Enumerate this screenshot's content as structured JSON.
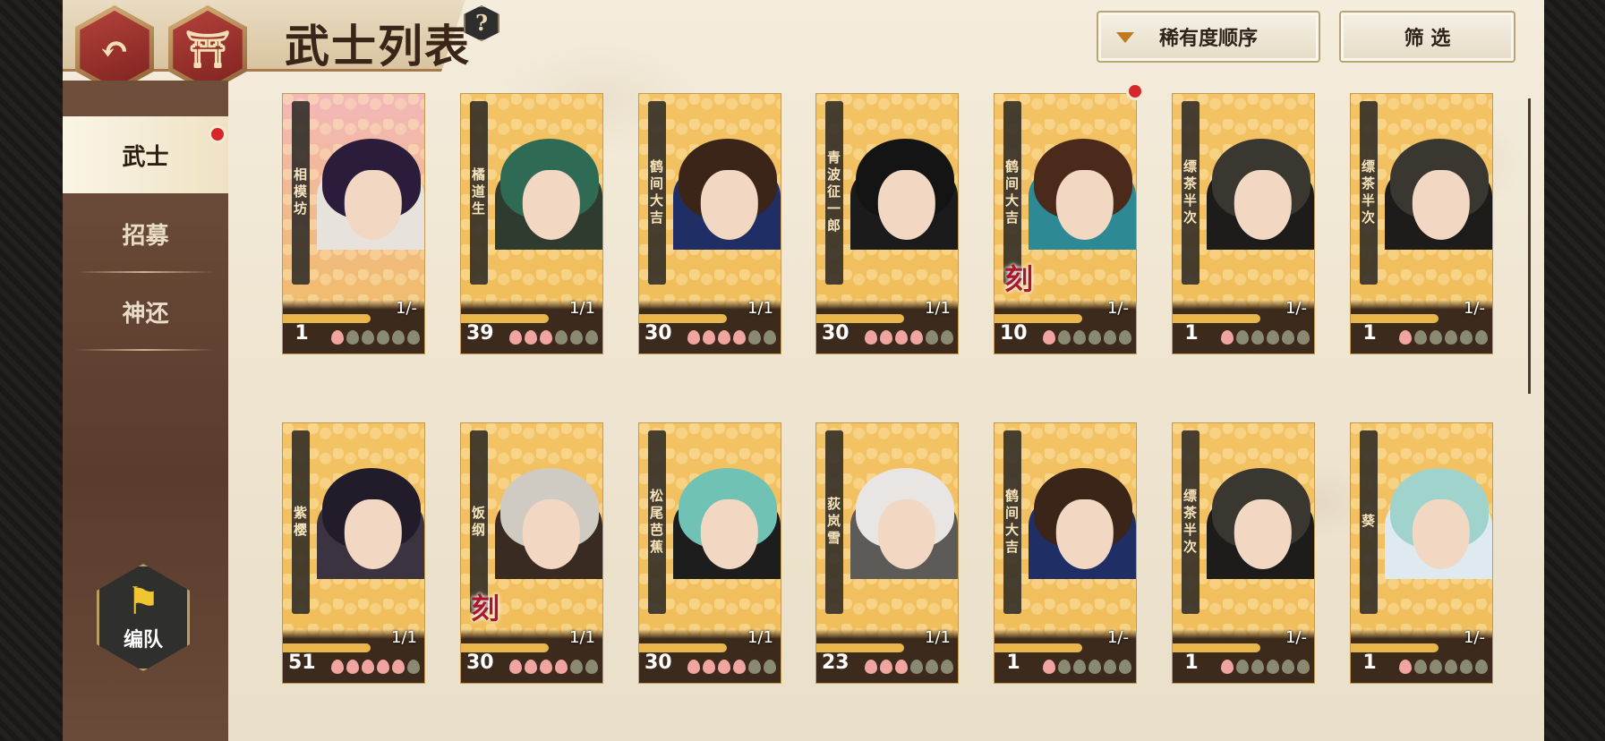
{
  "header": {
    "title": "武士列表",
    "help_label": "?",
    "sort_label": "稀有度顺序",
    "filter_label": "筛 选",
    "back_glyph": "↶",
    "home_glyph": "⛩"
  },
  "sidebar": {
    "items": [
      {
        "label": "武士",
        "active": true,
        "badge": true
      },
      {
        "label": "招募",
        "active": false,
        "badge": false
      },
      {
        "label": "神还",
        "active": false,
        "badge": false
      }
    ],
    "team": {
      "label": "编队",
      "flag": "⚑"
    }
  },
  "colors": {
    "accent_red": "#d9262a",
    "card_gold": "#f3c264",
    "sidebar_brown": "#5a3c2d",
    "petal_on": "#f0a5a0",
    "petal_off": "#8a8a72"
  },
  "cards": [
    {
      "name": "相模坊",
      "level": "1",
      "count": "1/-",
      "petals": 1,
      "theme": "red",
      "seal": "",
      "badge": false
    },
    {
      "name": "橘道生",
      "level": "39",
      "count": "1/1",
      "petals": 3,
      "theme": "green",
      "seal": "",
      "badge": false
    },
    {
      "name": "鹤间大吉",
      "level": "30",
      "count": "1/1",
      "petals": 4,
      "theme": "navy",
      "seal": "",
      "badge": false
    },
    {
      "name": "青波征一郎",
      "level": "30",
      "count": "1/1",
      "petals": 4,
      "theme": "black",
      "seal": "",
      "badge": false
    },
    {
      "name": "鹤间大吉",
      "level": "10",
      "count": "1/-",
      "petals": 1,
      "theme": "teal",
      "seal": "刻",
      "badge": true
    },
    {
      "name": "缥茶半次",
      "level": "1",
      "count": "1/-",
      "petals": 1,
      "theme": "dark",
      "seal": "",
      "badge": false
    },
    {
      "name": "缥茶半次",
      "level": "1",
      "count": "1/-",
      "petals": 1,
      "theme": "dark",
      "seal": "",
      "badge": false
    },
    {
      "name": "紫樱",
      "level": "51",
      "count": "1/1",
      "petals": 5,
      "theme": "purple",
      "seal": "",
      "badge": false
    },
    {
      "name": "饭纲",
      "level": "30",
      "count": "1/1",
      "petals": 4,
      "theme": "silver",
      "seal": "刻",
      "badge": false
    },
    {
      "name": "松尾芭蕉",
      "level": "30",
      "count": "1/1",
      "petals": 4,
      "theme": "mint",
      "seal": "",
      "badge": false
    },
    {
      "name": "荻岚雪",
      "level": "23",
      "count": "1/1",
      "petals": 3,
      "theme": "white",
      "seal": "",
      "badge": false
    },
    {
      "name": "鹤间大吉",
      "level": "1",
      "count": "1/-",
      "petals": 1,
      "theme": "navy",
      "seal": "",
      "badge": false
    },
    {
      "name": "缥茶半次",
      "level": "1",
      "count": "1/-",
      "petals": 1,
      "theme": "dark",
      "seal": "",
      "badge": false
    },
    {
      "name": "葵",
      "level": "1",
      "count": "1/-",
      "petals": 1,
      "theme": "ice",
      "seal": "",
      "badge": false
    }
  ]
}
